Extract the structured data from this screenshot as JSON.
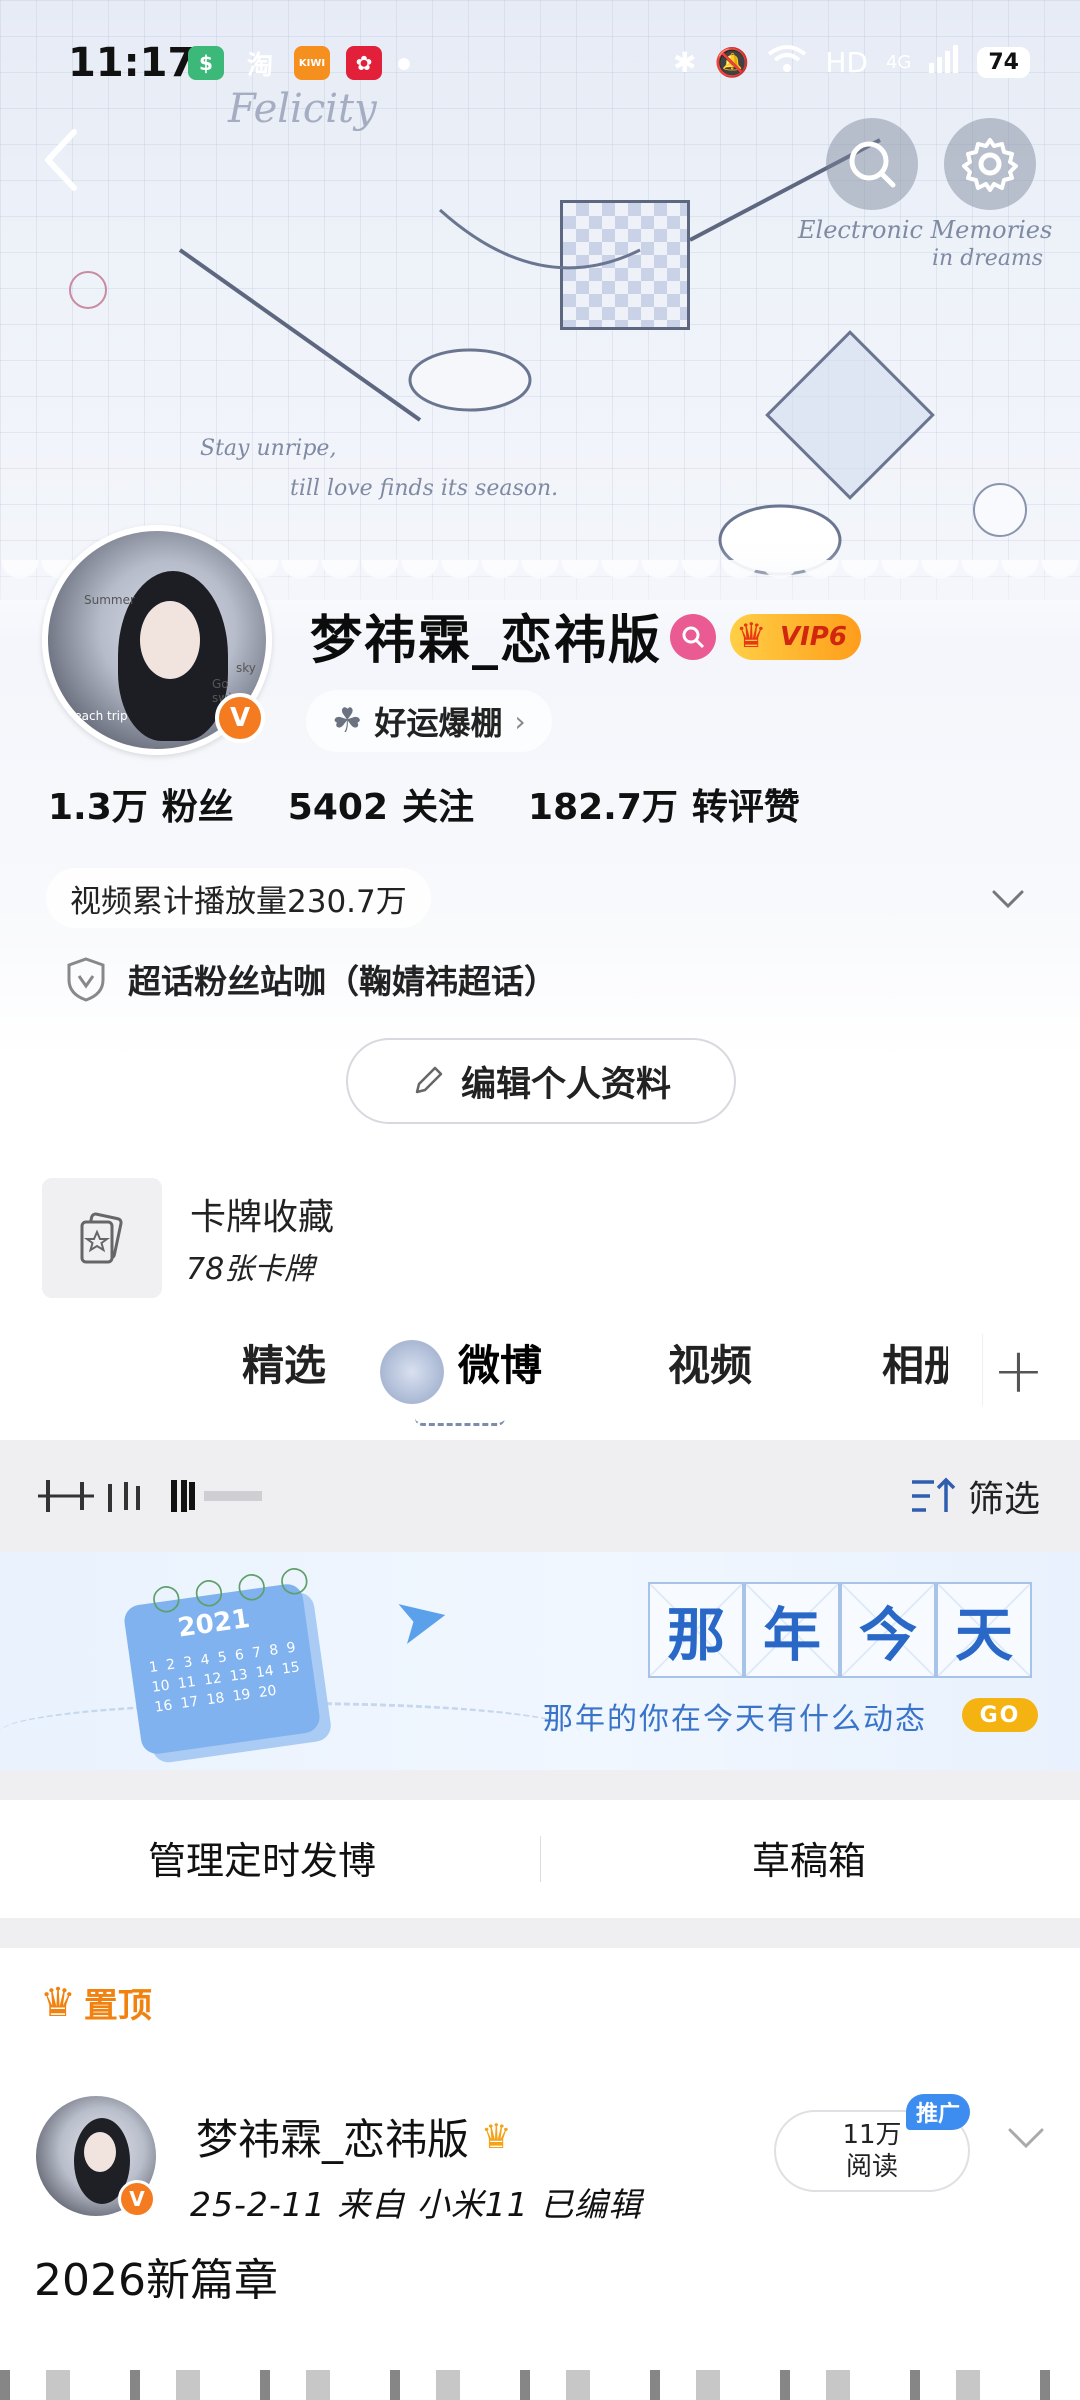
{
  "status_bar": {
    "time": "11:17",
    "apps": [
      "$",
      "淘",
      "KIWI",
      "✿"
    ],
    "network": "HD",
    "signal": "4G",
    "battery": "74"
  },
  "header": {
    "decor_texts": [
      "Felicity",
      "Stay unripe,",
      "till love finds its season.",
      "Electronic Memories",
      "in dreams"
    ]
  },
  "profile": {
    "avatar_texts": [
      "Summer",
      "sky",
      "Go swimming",
      "Beach trip"
    ],
    "nickname": "梦祎霖_恋祎版",
    "vip_label": "VIP6",
    "luck_label": "好运爆棚",
    "stats": [
      {
        "value": "1.3万",
        "label": "粉丝"
      },
      {
        "value": "5402",
        "label": "关注"
      },
      {
        "value": "182.7万",
        "label": "转评赞"
      }
    ],
    "plays_text": "视频累计播放量230.7万",
    "fans_text": "超话粉丝站咖（鞠婧祎超话）",
    "edit_label": "编辑个人资料"
  },
  "card_collection": {
    "title": "卡牌收藏",
    "subtitle": "78张卡牌"
  },
  "tabs": [
    {
      "label": "精选"
    },
    {
      "label": "微博"
    },
    {
      "label": "视频"
    },
    {
      "label": "相册"
    }
  ],
  "filter": {
    "label": "筛选"
  },
  "memory_banner": {
    "title_chars": [
      "那",
      "年",
      "今",
      "天"
    ],
    "calendar_year": "2021",
    "subtitle": "那年的你在今天有什么动态",
    "go_label": "GO"
  },
  "actions": {
    "scheduled": "管理定时发博",
    "drafts": "草稿箱"
  },
  "pinned_section": {
    "label": "置顶"
  },
  "post": {
    "author": "梦祎霖_恋祎版",
    "meta": "25-2-11  来自 小米11  已编辑",
    "reads_value": "11万",
    "reads_label": "阅读",
    "promo_label": "推广",
    "text": "2026新篇章"
  },
  "colors": {
    "accent_orange": "#f47b20",
    "memory_blue": "#2968c7",
    "promo_blue": "#3d8df0",
    "pinned_orange": "#f2820f"
  }
}
